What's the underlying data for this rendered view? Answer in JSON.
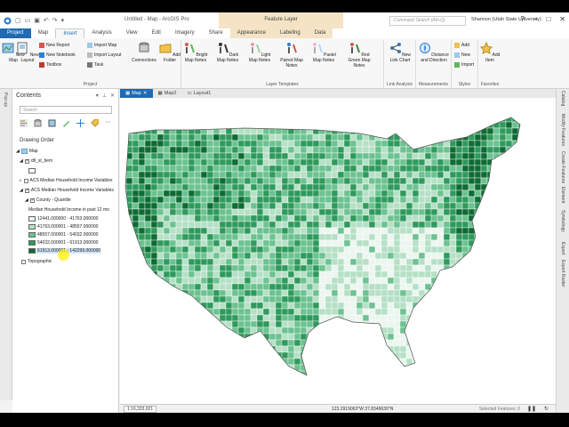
{
  "app": {
    "title": "Untitled - Map - ArcGIS Pro",
    "context_tab_header": "Feature Layer",
    "search_placeholder": "Command Search (Alt+Q)",
    "user": "Shannon (Utah State University)"
  },
  "tabs": [
    "Project",
    "Map",
    "Insert",
    "Analysis",
    "View",
    "Edit",
    "Imagery",
    "Share",
    "Appearance",
    "Labeling",
    "Data"
  ],
  "active_tab": "Insert",
  "ribbon": {
    "project": {
      "new_map": "New Map",
      "new_layout": "New Layout",
      "new_report": "New Report",
      "new_notebook": "New Notebook",
      "toolbox": "Toolbox",
      "import_map": "Import Map",
      "import_layout": "Import Layout",
      "task": "Task",
      "connections": "Connections",
      "add_folder": "Add Folder",
      "label": "Project"
    },
    "layer_templates": {
      "items": [
        "Bright Map Notes",
        "Dark Map Notes",
        "Light Map Notes",
        "Paired Map Notes",
        "Pastel Map Notes",
        "Red Green Map Notes"
      ],
      "label": "Layer Templates"
    },
    "link_analysis": {
      "new_link_chart": "New Link Chart",
      "label": "Link Analysis"
    },
    "measurements": {
      "distance_direction": "Distance and Direction",
      "label": "Measurements"
    },
    "styles": {
      "add": "Add",
      "new": "New",
      "import": "Import",
      "label": "Styles"
    },
    "favorites": {
      "add_item": "Add Item",
      "label": "Favorites"
    }
  },
  "left_strip": "Pop-up",
  "contents": {
    "title": "Contents",
    "search_placeholder": "Search",
    "drawing_order": "Drawing Order",
    "map_name": "Map",
    "layers": [
      "dtl_st_tiern",
      "ACS Median Household Income Variables",
      "ACS Median Household Income Variables"
    ],
    "sublayer": "County - Quantile",
    "legend_title": "Median Household Income in past 12 mo",
    "legend": [
      {
        "label": "12441.000000 - 41763.000000",
        "color": "#ebf6ef"
      },
      {
        "label": "41763.000001 - 48557.000000",
        "color": "#b6e0c6"
      },
      {
        "label": "48557.000001 - 54032.000000",
        "color": "#6cc290"
      },
      {
        "label": "54032.000001 - 61913.000000",
        "color": "#2e9a5c"
      },
      {
        "label": "61913.000001 - 142299.000000",
        "color": "#0e6b33"
      }
    ],
    "basemap": "Topographic"
  },
  "views": [
    "Map",
    "Map2",
    "Layout1"
  ],
  "status": {
    "scale": "1:16,333,921",
    "coords": "123.2919063°W 37.8349630°N",
    "selected": "Selected Features: 0"
  },
  "right_strip": [
    "Catalog",
    "Modify Features",
    "Create Features",
    "Element",
    "Symbology",
    "Export",
    "Export Raster"
  ]
}
